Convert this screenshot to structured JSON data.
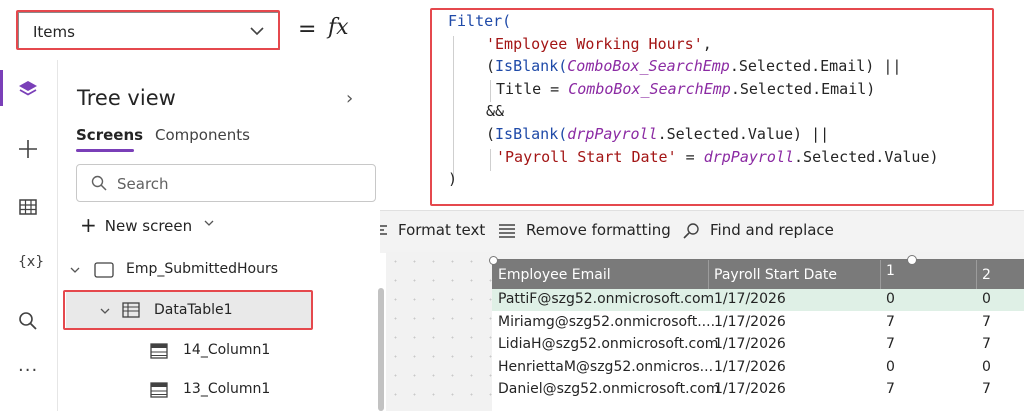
{
  "formula_bar": {
    "property": "Items",
    "equals": "=",
    "fx": "fx"
  },
  "formula": {
    "lines": [
      {
        "parts": [
          {
            "t": "Filter(",
            "c": "kw"
          }
        ]
      },
      {
        "parts": [
          {
            "t": "'Employee Working Hours'",
            "c": "str"
          },
          {
            "t": ",",
            "c": ""
          }
        ]
      },
      {
        "parts": [
          {
            "t": "(",
            "c": ""
          },
          {
            "t": "IsBlank(",
            "c": "kw"
          },
          {
            "t": "ComboBox_SearchEmp",
            "c": "ctl"
          },
          {
            "t": ".Selected.Email) ||",
            "c": ""
          }
        ]
      },
      {
        "parts": [
          {
            "t": "Title = ",
            "c": ""
          },
          {
            "t": "ComboBox_SearchEmp",
            "c": "ctl"
          },
          {
            "t": ".Selected.Email)",
            "c": ""
          }
        ]
      },
      {
        "parts": [
          {
            "t": "&&",
            "c": ""
          }
        ]
      },
      {
        "parts": [
          {
            "t": "(",
            "c": ""
          },
          {
            "t": "IsBlank(",
            "c": "kw"
          },
          {
            "t": "drpPayroll",
            "c": "ctl"
          },
          {
            "t": ".Selected.Value) ||",
            "c": ""
          }
        ]
      },
      {
        "parts": [
          {
            "t": "'Payroll Start Date'",
            "c": "str"
          },
          {
            "t": " = ",
            "c": ""
          },
          {
            "t": "drpPayroll",
            "c": "ctl"
          },
          {
            "t": ".Selected.Value)",
            "c": ""
          }
        ]
      },
      {
        "parts": [
          {
            "t": ")",
            "c": ""
          }
        ]
      }
    ]
  },
  "format_toolbar": {
    "format_text": "Format text",
    "remove_formatting": "Remove formatting",
    "find_replace": "Find and replace"
  },
  "tree_view": {
    "title": "Tree view",
    "tab_screens": "Screens",
    "tab_components": "Components",
    "search_placeholder": "Search",
    "new_screen": "New screen",
    "screen_name": "Emp_SubmittedHours",
    "datatable_name": "DataTable1",
    "col14": "14_Column1",
    "col13": "13_Column1"
  },
  "datatable": {
    "headers": [
      "Employee Email",
      "Payroll Start Date",
      "1",
      "2"
    ],
    "rows": [
      [
        "PattiF@szg52.onmicrosoft.com",
        "1/17/2026",
        "0",
        "0"
      ],
      [
        "Miriamg@szg52.onmicrosoft....",
        "1/17/2026",
        "7",
        "7"
      ],
      [
        "LidiaH@szg52.onmicrosoft.com",
        "1/17/2026",
        "7",
        "7"
      ],
      [
        "HenriettaM@szg52.onmicros...",
        "1/17/2026",
        "0",
        "0"
      ],
      [
        "Daniel@szg52.onmicrosoft.com",
        "1/17/2026",
        "7",
        "7"
      ]
    ]
  },
  "colors": {
    "highlight": "#e5484d",
    "accent": "#7a3fb8",
    "header_bg": "#7a7a7a",
    "selected_row": "#dff0e6"
  },
  "icons": {
    "rail": [
      "layers-icon",
      "plus-icon",
      "data-table-icon",
      "variables-icon",
      "search-icon",
      "more-icon"
    ]
  }
}
